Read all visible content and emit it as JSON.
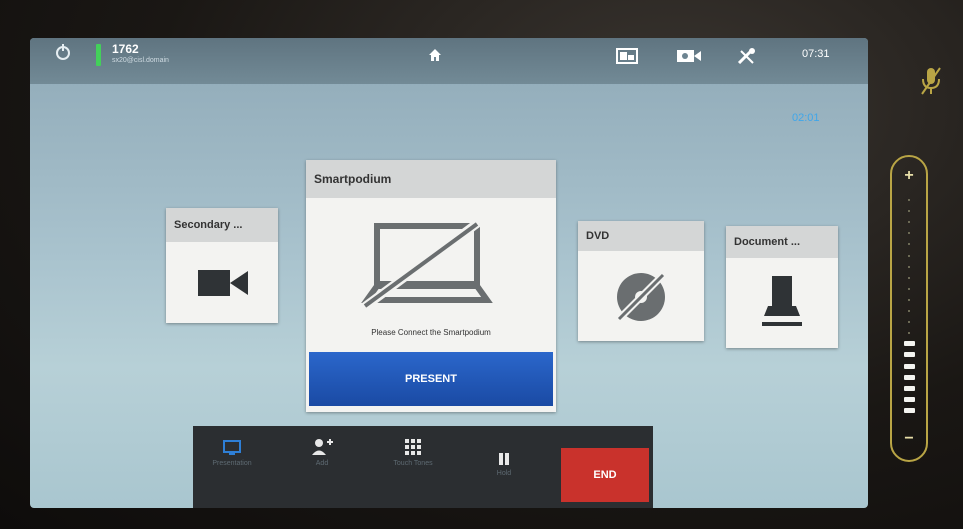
{
  "status": {
    "system_number": "1762",
    "system_address": "sx20@cisl.domain",
    "clock": "07:31",
    "call_duration": "02:01"
  },
  "sources": {
    "secondary": {
      "label": "Secondary ...",
      "icon": "camera-icon"
    },
    "main": {
      "label": "Smartpodium",
      "message": "Please Connect the Smartpodium",
      "present_label": "PRESENT",
      "icon": "laptop-disconnected-icon"
    },
    "dvd": {
      "label": "DVD",
      "icon": "disc-disconnected-icon"
    },
    "document": {
      "label": "Document ...",
      "icon": "document-camera-icon"
    }
  },
  "bottom_bar": {
    "presentation_label": "Presentation",
    "add_label": "Add",
    "touch_tones_label": "Touch Tones",
    "hold_label": "Hold",
    "end_label": "END"
  },
  "volume": {
    "level_fraction": 0.35,
    "plus": "+",
    "minus": "−"
  },
  "colors": {
    "present_blue": "#1f56b8",
    "end_red": "#c9322c",
    "signal_green": "#43d05a",
    "duration_blue": "#3fa6ea",
    "volume_gold": "#b9a545"
  }
}
